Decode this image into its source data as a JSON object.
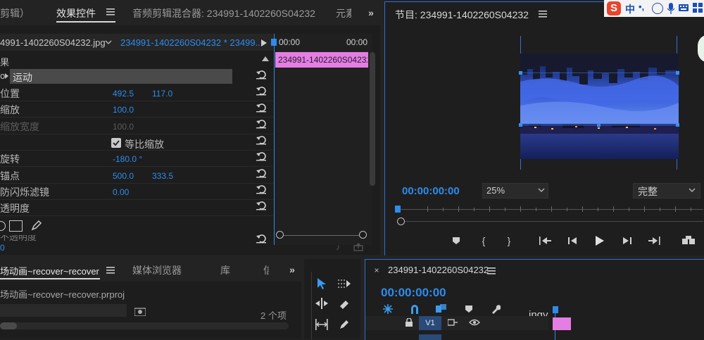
{
  "effect_controls": {
    "tab_prev": "剪辑）",
    "tab_active": "效果控件",
    "tab_audio_mixer": "音频剪辑混合器: 234991-1402260S04232",
    "tab_next": "元素",
    "source_clip": "4991-1402260S04232.jpg",
    "sequence_clip": "234991-1402260S04232 * 23499...",
    "section_label": "果",
    "motion_label": "运动",
    "time_start": "00:00",
    "time_end": "00:00",
    "timeline_clip": "234991-1402260S04232",
    "properties": [
      {
        "label": "位置",
        "v1": "492.5",
        "v2": "117.0"
      },
      {
        "label": "缩放",
        "v1": "100.0",
        "v2": ""
      },
      {
        "label": "缩放宽度",
        "v1": "100.0",
        "v2": ""
      },
      {
        "label": "",
        "v1": "",
        "v2": ""
      },
      {
        "label": "旋转",
        "v1": "-180.0 °",
        "v2": ""
      },
      {
        "label": "锚点",
        "v1": "500.0",
        "v2": "333.5"
      },
      {
        "label": "防闪烁滤镜",
        "v1": "0.00",
        "v2": ""
      },
      {
        "label": "透明度",
        "v1": "",
        "v2": ""
      }
    ],
    "uniform_scale_label": "等比缩放",
    "partial_row": "不透明度",
    "bottom_value": "0"
  },
  "program_monitor": {
    "title": "节目: 234991-1402260S04232",
    "timecode": "00:00:00:00",
    "zoom": "25%",
    "quality": "完整"
  },
  "project_panel": {
    "tab_project": "场动画~recover~recover",
    "tab_media": "媒体浏览器",
    "tab_library": "库",
    "tab_more": "信",
    "file_name": "场动画~recover~recover.prproj",
    "item_count": "2 个项"
  },
  "timeline": {
    "title": "234991-1402260S04232",
    "timecode": "00:00:00:00",
    "track_label": "V1",
    "clip_text": "ingy"
  },
  "ime_toolbar": {
    "logo": "S",
    "lang": "中",
    "punct": "•,"
  }
}
